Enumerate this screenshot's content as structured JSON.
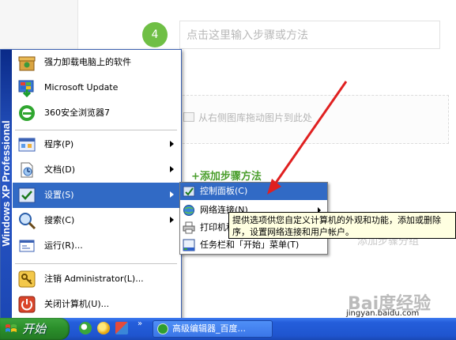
{
  "background_page": {
    "step_number": "4",
    "step_input_placeholder": "点击这里输入步骤或方法",
    "upload_hint": "从右侧图库拖动图片到此处",
    "add_step_label": "+添加步骤方法",
    "add_step_label_2": "添加步骤分组"
  },
  "start_menu": {
    "side_band_text": "Windows XP Professional",
    "pinned": [
      {
        "label": "强力卸载电脑上的软件",
        "icon": "uninstall-box-icon"
      },
      {
        "label": "Microsoft Update",
        "icon": "windows-update-icon"
      },
      {
        "label": "360安全浏览器7",
        "icon": "browser-360-icon"
      }
    ],
    "items": [
      {
        "label": "程序(P)",
        "icon": "programs-icon",
        "submenu": true
      },
      {
        "label": "文档(D)",
        "icon": "documents-icon",
        "submenu": true
      },
      {
        "label": "设置(S)",
        "icon": "settings-icon",
        "submenu": true,
        "highlighted": true
      },
      {
        "label": "搜索(C)",
        "icon": "search-icon",
        "submenu": true
      },
      {
        "label": "运行(R)...",
        "icon": "run-icon",
        "submenu": false
      }
    ],
    "footer": [
      {
        "label": "注销 Administrator(L)...",
        "icon": "logoff-key-icon"
      },
      {
        "label": "关闭计算机(U)...",
        "icon": "power-icon"
      }
    ]
  },
  "settings_submenu": {
    "items": [
      {
        "label": "控制面板(C)",
        "icon": "control-panel-icon",
        "highlighted": true
      },
      {
        "label": "网络连接(N)",
        "icon": "network-icon",
        "submenu": true
      },
      {
        "label": "打印机和传真(P)",
        "icon": "printer-icon"
      },
      {
        "label": "任务栏和「开始」菜单(T)",
        "icon": "taskbar-icon"
      }
    ]
  },
  "tooltip": {
    "line1": "提供选项供您自定义计算机的外观和功能，添加或删除",
    "line2": "序，设置网络连接和用户帐户。"
  },
  "taskbar": {
    "start_label": "开始",
    "task_button_label": "高级编辑器_百度...",
    "quick_launch": [
      "ie-icon",
      "360-icon",
      "show-desktop-icon"
    ]
  },
  "watermark": {
    "logo": "Bai度经验",
    "url": "jingyan.baidu.com"
  },
  "colors": {
    "highlight": "#316ac5",
    "taskbar": "#245edb",
    "start_button": "#2b8f2b",
    "accent_green": "#6fbf45",
    "arrow_red": "#e02020"
  }
}
